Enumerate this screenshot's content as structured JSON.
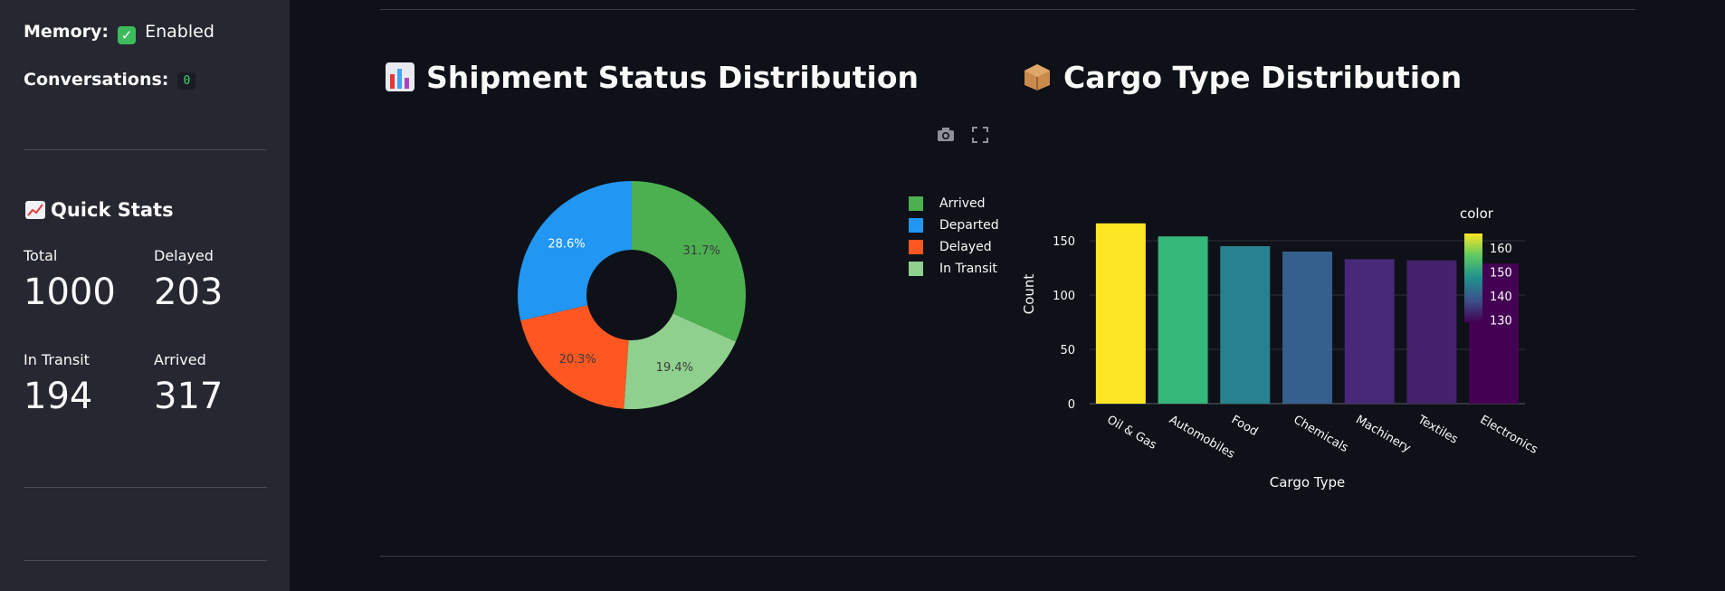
{
  "sidebar": {
    "memory_label": "Memory:",
    "memory_value": "Enabled",
    "conversations_label": "Conversations:",
    "conversations_value": "0",
    "quick_stats_title": "Quick Stats",
    "metrics": [
      {
        "label": "Total",
        "value": "1000"
      },
      {
        "label": "Delayed",
        "value": "203"
      },
      {
        "label": "In Transit",
        "value": "194"
      },
      {
        "label": "Arrived",
        "value": "317"
      }
    ]
  },
  "main": {
    "shipment_title": "Shipment Status Distribution",
    "cargo_title": "Cargo Type Distribution"
  },
  "pie_chart": {
    "type": "pie",
    "donut": true,
    "slices": [
      {
        "label": "Arrived",
        "value": 317,
        "pct": "31.7%",
        "color": "#4caf50"
      },
      {
        "label": "Departed",
        "value": 286,
        "pct": "28.6%",
        "color": "#2196f3"
      },
      {
        "label": "Delayed",
        "value": 203,
        "pct": "20.3%",
        "color": "#ff5722"
      },
      {
        "label": "In Transit",
        "value": 194,
        "pct": "19.4%",
        "color": "#90d08e"
      }
    ]
  },
  "chart_data": {
    "type": "bar",
    "xlabel": "Cargo Type",
    "ylabel": "Count",
    "categories": [
      "Oil & Gas",
      "Automobiles",
      "Food",
      "Chemicals",
      "Machinery",
      "Textiles",
      "Electronics"
    ],
    "values": [
      166,
      154,
      145,
      140,
      133,
      132,
      129
    ],
    "colors": [
      "#fde725",
      "#35b779",
      "#26828e",
      "#355f8d",
      "#482878",
      "#46216c",
      "#440154"
    ],
    "yticks": [
      0,
      50,
      100,
      150
    ],
    "ylim": [
      0,
      175
    ],
    "colorbar_title": "color",
    "colorbar_ticks": [
      130,
      140,
      150,
      160
    ]
  }
}
